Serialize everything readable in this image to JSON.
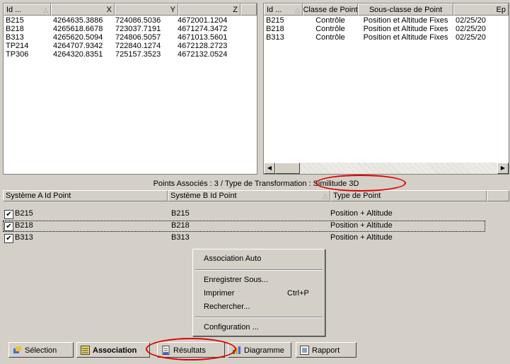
{
  "left_table": {
    "columns": [
      "Id ...",
      "X",
      "Y",
      "Z"
    ],
    "rows": [
      [
        "B215",
        "4264635.3886",
        "724086.5036",
        "4672001.1204"
      ],
      [
        "B218",
        "4265618.6678",
        "723037.7191",
        "4671274.3472"
      ],
      [
        "B313",
        "4265620.5094",
        "724806.5057",
        "4671013.5601"
      ],
      [
        "TP214",
        "4264707.9342",
        "722840.1274",
        "4672128.2723"
      ],
      [
        "TP306",
        "4264320.8351",
        "725157.3523",
        "4672132.0524"
      ]
    ]
  },
  "right_table": {
    "columns": [
      "Id ...",
      "Classe de Point",
      "Sous-classe de Point",
      "Ep"
    ],
    "rows": [
      [
        "B215",
        "Contrôle",
        "Position et Altitude Fixes",
        "02/25/20"
      ],
      [
        "B218",
        "Contrôle",
        "Position et Altitude Fixes",
        "02/25/20"
      ],
      [
        "B313",
        "Contrôle",
        "Position et Altitude Fixes",
        "02/25/20"
      ]
    ]
  },
  "info_bar": "Points Associés : 3  /  Type de Transformation : Similitude 3D",
  "assoc_table": {
    "columns": [
      "Système A Id Point",
      "Système B Id Point",
      "Type de Point"
    ],
    "rows": [
      {
        "a": "B215",
        "b": "B215",
        "type": "Position + Altitude",
        "checked": true
      },
      {
        "a": "B218",
        "b": "B218",
        "type": "Position + Altitude",
        "checked": true
      },
      {
        "a": "B313",
        "b": "B313",
        "type": "Position + Altitude",
        "checked": true
      }
    ]
  },
  "context_menu": {
    "association_auto": "Association Auto",
    "enregistrer_sous": "Enregistrer Sous...",
    "imprimer": "Imprimer",
    "imprimer_shortcut": "Ctrl+P",
    "rechercher": "Rechercher...",
    "configuration": "Configuration ..."
  },
  "tabs": {
    "selection": "Sélection",
    "association": "Association",
    "resultats": "Résultats",
    "diagramme": "Diagramme",
    "rapport": "Rapport"
  },
  "colors": {
    "highlight_oval": "#e00000",
    "window_bg": "#d4d0c8"
  },
  "icons": [
    "selection-icon",
    "association-icon",
    "results-icon",
    "diagram-icon",
    "report-icon"
  ]
}
